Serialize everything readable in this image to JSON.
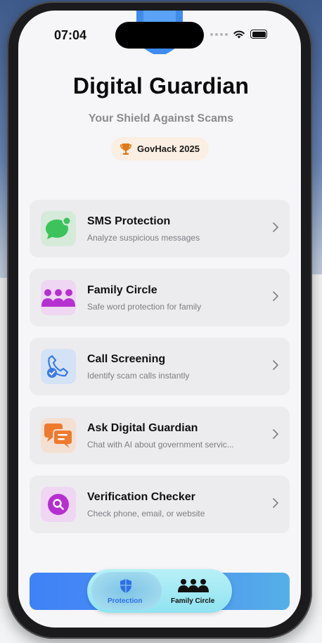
{
  "status_bar": {
    "time": "07:04"
  },
  "header": {
    "title": "Digital Guardian",
    "subtitle": "Your Shield Against Scams",
    "badge": "GovHack 2025"
  },
  "features": [
    {
      "title": "SMS Protection",
      "subtitle": "Analyze suspicious messages",
      "icon": "message-icon"
    },
    {
      "title": "Family Circle",
      "subtitle": "Safe word protection for family",
      "icon": "family-icon"
    },
    {
      "title": "Call Screening",
      "subtitle": "Identify scam calls instantly",
      "icon": "phone-check-icon"
    },
    {
      "title": "Ask Digital Guardian",
      "subtitle": "Chat with AI about government servic...",
      "icon": "chat-icon"
    },
    {
      "title": "Verification Checker",
      "subtitle": "Check phone, email, or website",
      "icon": "search-icon"
    }
  ],
  "tabbar": {
    "tabs": [
      {
        "label": "Protection",
        "active": true
      },
      {
        "label": "Family Circle",
        "active": false
      }
    ]
  },
  "colors": {
    "accent_blue": "#3e82f6",
    "sms_green": "#3cc35c",
    "family_purple": "#b52fd1",
    "call_blue": "#3a7ae6",
    "chat_orange": "#ee7a2e",
    "verify_purple": "#b52fd1",
    "badge_bg": "#fbeee2",
    "trophy_orange": "#e07a16"
  }
}
